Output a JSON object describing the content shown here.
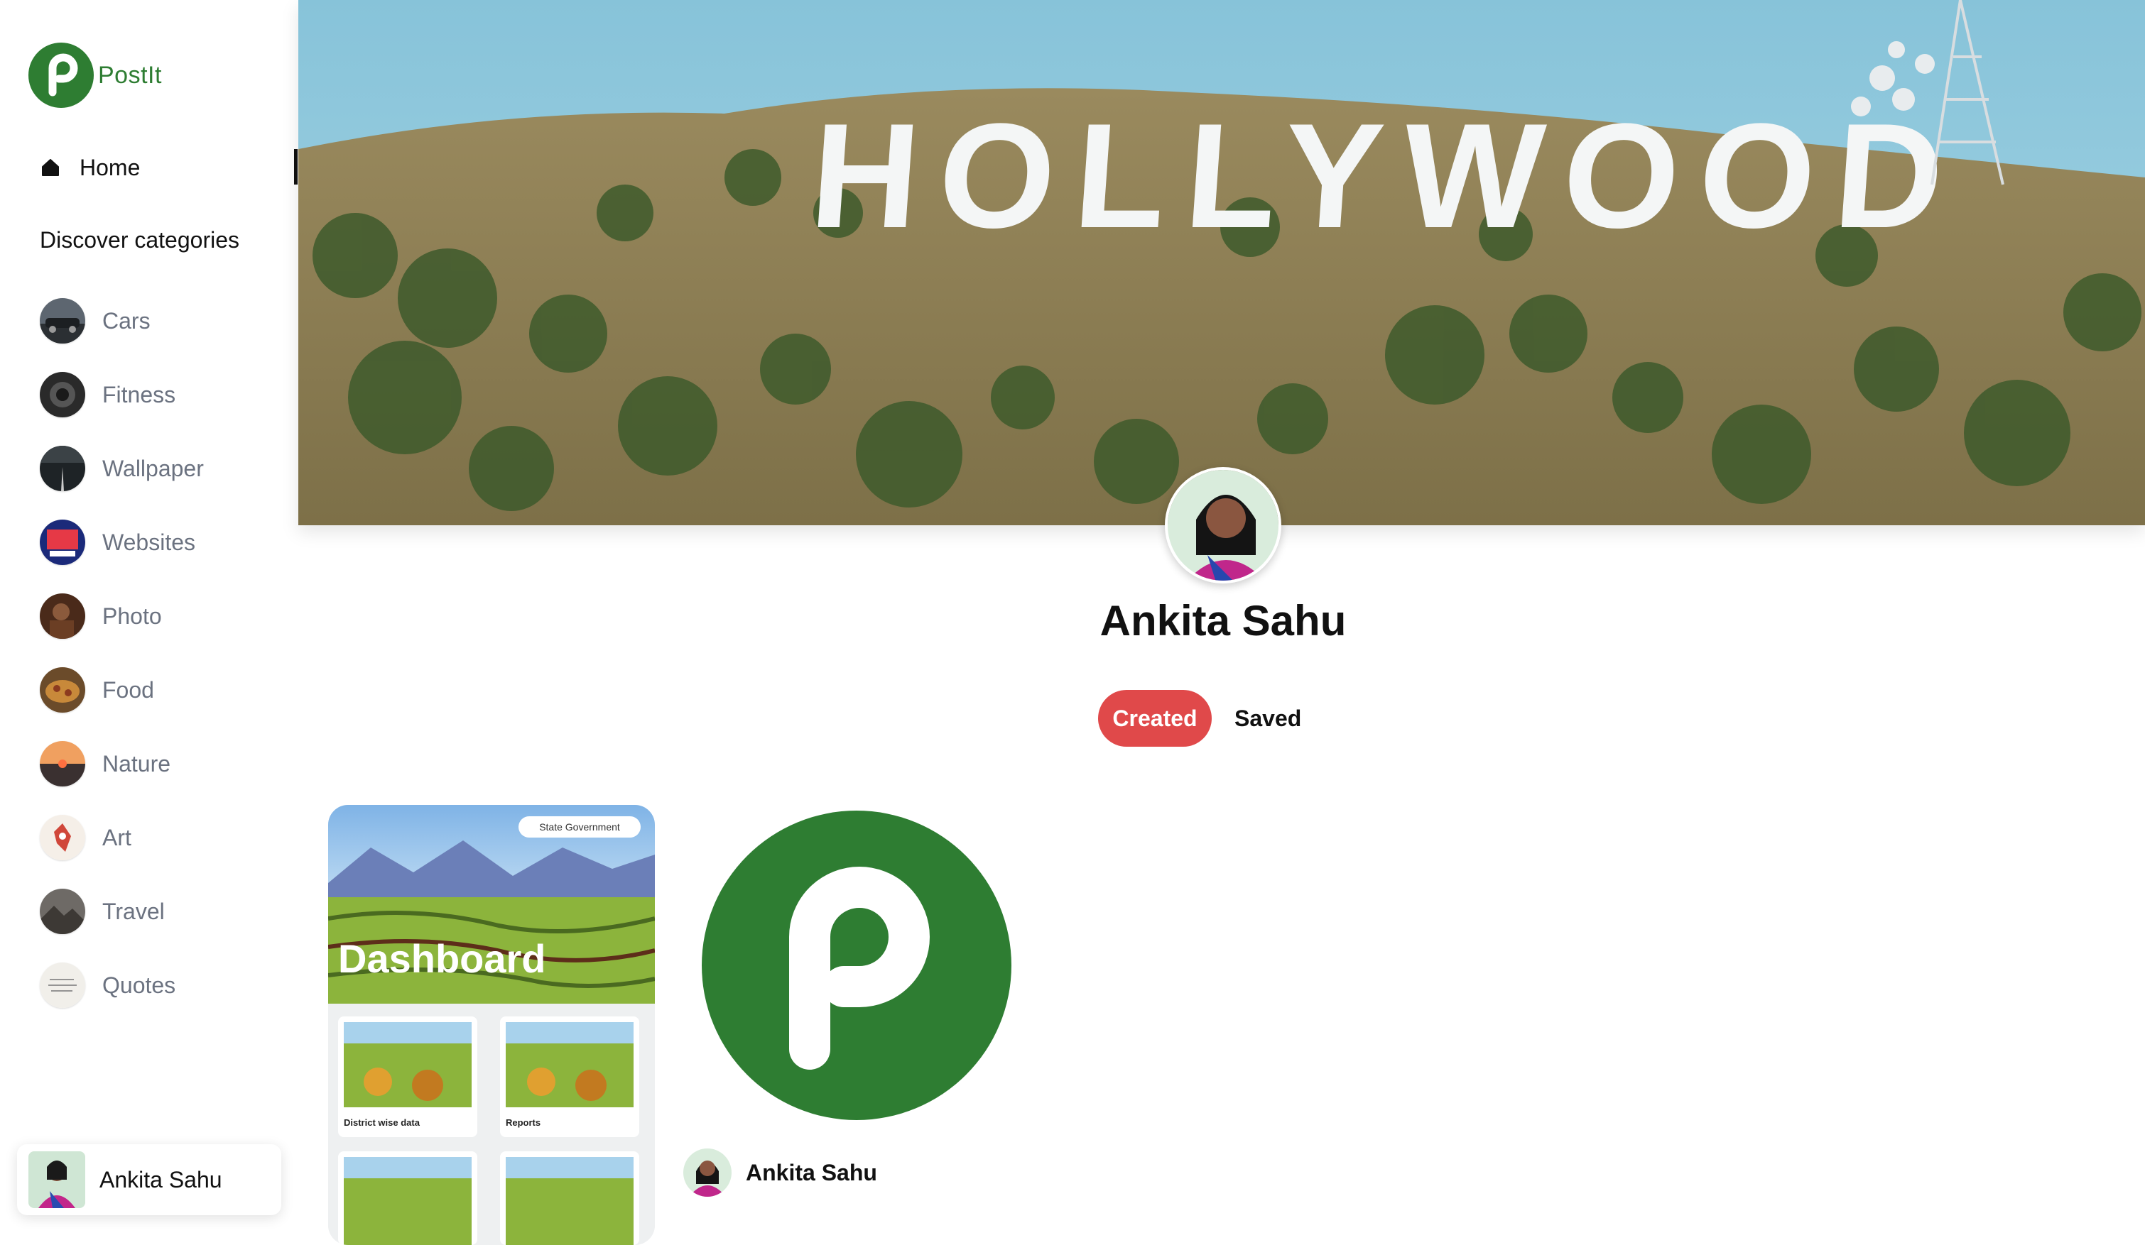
{
  "app": {
    "name": "PostIt",
    "brand_color": "#2e7d32",
    "logo_icon": "postit-logo-icon"
  },
  "sidebar": {
    "home_label": "Home",
    "home_icon": "home-icon",
    "section_title": "Discover categories",
    "categories": [
      {
        "label": "Cars"
      },
      {
        "label": "Fitness"
      },
      {
        "label": "Wallpaper"
      },
      {
        "label": "Websites"
      },
      {
        "label": "Photo"
      },
      {
        "label": "Food"
      },
      {
        "label": "Nature"
      },
      {
        "label": "Art"
      },
      {
        "label": "Travel"
      },
      {
        "label": "Quotes"
      }
    ],
    "user": {
      "name": "Ankita Sahu"
    }
  },
  "profile": {
    "cover_text": "HOLLYWOOD",
    "name": "Ankita Sahu",
    "tabs": {
      "created": "Created",
      "saved": "Saved"
    },
    "active_tab_color": "#e0494a"
  },
  "pins": [
    {
      "title": "Dashboard",
      "badge": "State Government",
      "tiles": [
        "District wise data",
        "Reports"
      ]
    },
    {
      "image": "postit-logo",
      "author": "Ankita Sahu"
    }
  ]
}
